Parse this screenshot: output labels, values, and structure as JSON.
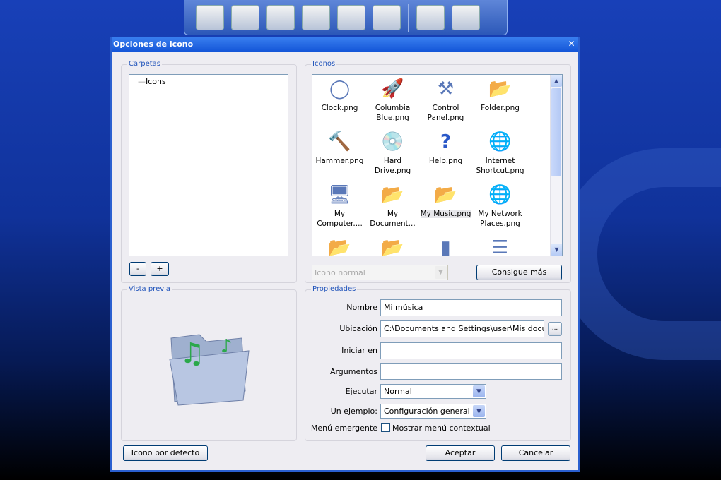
{
  "dialog": {
    "title": "Opciones de icono",
    "close": "✕"
  },
  "carpetas": {
    "legend": "Carpetas",
    "tree": [
      "Icons"
    ],
    "minus": "-",
    "plus": "+"
  },
  "iconos": {
    "legend": "Iconos",
    "items": [
      {
        "label": "Clock.png",
        "glyph": "◯"
      },
      {
        "label": "Columbia Blue.png",
        "glyph": "🚀"
      },
      {
        "label": "Control Panel.png",
        "glyph": "⚒"
      },
      {
        "label": "Folder.png",
        "glyph": "📂"
      },
      {
        "label": "Hammer.png",
        "glyph": "🔨"
      },
      {
        "label": "Hard Drive.png",
        "glyph": "💿"
      },
      {
        "label": "Help.png",
        "glyph": "?"
      },
      {
        "label": "Internet Shortcut.png",
        "glyph": "🌐"
      },
      {
        "label": "My Computer....",
        "glyph": "🖥"
      },
      {
        "label": "My Document...",
        "glyph": "📂"
      },
      {
        "label": "My Music.png",
        "glyph": "📂"
      },
      {
        "label": "My Network Places.png",
        "glyph": "🌐"
      },
      {
        "label": "",
        "glyph": "📂"
      },
      {
        "label": "",
        "glyph": "📂"
      },
      {
        "label": "",
        "glyph": "▮"
      },
      {
        "label": "",
        "glyph": "☰"
      }
    ],
    "selected": "My Music.png",
    "type_select": "Icono normal",
    "get_more": "Consigue más"
  },
  "preview": {
    "legend": "Vista previa"
  },
  "props": {
    "legend": "Propiedades",
    "nombre_label": "Nombre",
    "nombre": "Mi música",
    "ubicacion_label": "Ubicación",
    "ubicacion": "C:\\Documents and Settings\\user\\Mis docume",
    "browse": "...",
    "iniciar_label": "Iniciar en",
    "iniciar": "",
    "argumentos_label": "Argumentos",
    "argumentos": "",
    "ejecutar_label": "Ejecutar",
    "ejecutar": "Normal",
    "ejemplo_label": "Un ejemplo:",
    "ejemplo": "Configuración general",
    "menu_label": "Menú emergente",
    "menu_check": "Mostrar menú contextual",
    "menu_checked": false
  },
  "buttons": {
    "default_icon": "Icono por defecto",
    "ok": "Aceptar",
    "cancel": "Cancelar"
  }
}
